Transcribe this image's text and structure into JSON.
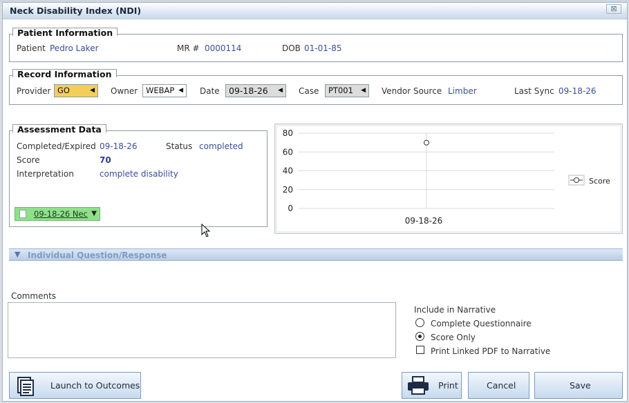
{
  "dialog": {
    "title": "Neck Disability Index (NDI)",
    "close_glyph": "⊠"
  },
  "patient_info": {
    "legend": "Patient Information",
    "patient_label": "Patient",
    "patient_value": "Pedro Laker",
    "mr_label": "MR #",
    "mr_value": "0000114",
    "dob_label": "DOB",
    "dob_value": "01-01-85"
  },
  "record_info": {
    "legend": "Record Information",
    "provider_label": "Provider",
    "provider_value": "GO",
    "owner_label": "Owner",
    "owner_value": "WEBAP",
    "date_label": "Date",
    "date_value": "09-18-26",
    "case_label": "Case",
    "case_value": "PT001",
    "vendor_label": "Vendor Source",
    "vendor_value": "Limber",
    "sync_label": "Last Sync",
    "sync_value": "09-18-26"
  },
  "assessment": {
    "legend": "Assessment Data",
    "completed_label": "Completed/Expired",
    "completed_value": "09-18-26",
    "status_label": "Status",
    "status_value": "completed",
    "score_label": "Score",
    "score_value": "70",
    "interp_label": "Interpretation",
    "interp_value": "complete disability",
    "doc_select_value": "09-18-26 Nec"
  },
  "chart_data": {
    "type": "line",
    "categories": [
      "09-18-26"
    ],
    "series": [
      {
        "name": "Score",
        "values": [
          70
        ]
      }
    ],
    "ylim": [
      0,
      80
    ],
    "yticks": [
      0,
      20,
      40,
      60,
      80
    ],
    "grid": true,
    "legend_position": "right"
  },
  "section": {
    "label": "Individual Question/Response"
  },
  "comments": {
    "label": "Comments",
    "value": ""
  },
  "narrative": {
    "label": "Include in Narrative",
    "options": [
      "Complete Questionnaire",
      "Score Only"
    ],
    "selected": "Score Only",
    "pdf_label": "Print Linked PDF to Narrative",
    "pdf_checked": false
  },
  "buttons": {
    "launch": "Launch to Outcomes",
    "print": "Print",
    "cancel": "Cancel",
    "save": "Save"
  },
  "colors": {
    "provider_highlight": "#f3cf5a",
    "doc_select": "#8fe08a",
    "value_text": "#3a4e9a"
  }
}
